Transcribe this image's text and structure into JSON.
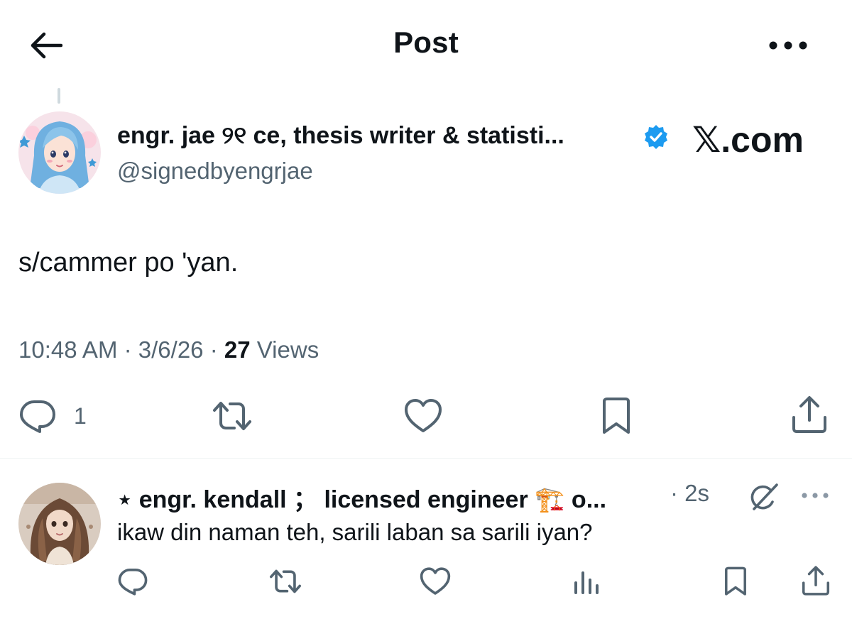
{
  "header": {
    "title": "Post",
    "back_icon": "arrow-left-icon",
    "more_icon": "more-horizontal-icon"
  },
  "post": {
    "author_name": "engr. jae ୨୧ ce, thesis writer & statisti...",
    "handle": "@signedbyengrjae",
    "verified": true,
    "watermark": "𝕏.com",
    "text": "s/cammer po 'yan.",
    "time": "10:48 AM",
    "date": "3/6/26",
    "views_count": "27",
    "views_label": "Views",
    "actions": {
      "reply_count": "1",
      "icons": [
        "reply-icon",
        "repost-icon",
        "like-icon",
        "bookmark-icon",
        "share-icon"
      ]
    }
  },
  "reply": {
    "author_name": "⋆ engr. kendall ； licensed engineer 🏗️ o...",
    "time": "· 2s",
    "text": "ikaw din naman teh, sarili laban sa sarili iyan?",
    "icons": [
      "reply-icon",
      "repost-icon",
      "like-icon",
      "views-icon",
      "bookmark-icon",
      "share-icon",
      "grok-icon",
      "more-icon"
    ]
  },
  "colors": {
    "text_primary": "#0f1419",
    "text_secondary": "#536471",
    "verified_blue": "#1d9bf0",
    "divider": "#eff3f4"
  }
}
